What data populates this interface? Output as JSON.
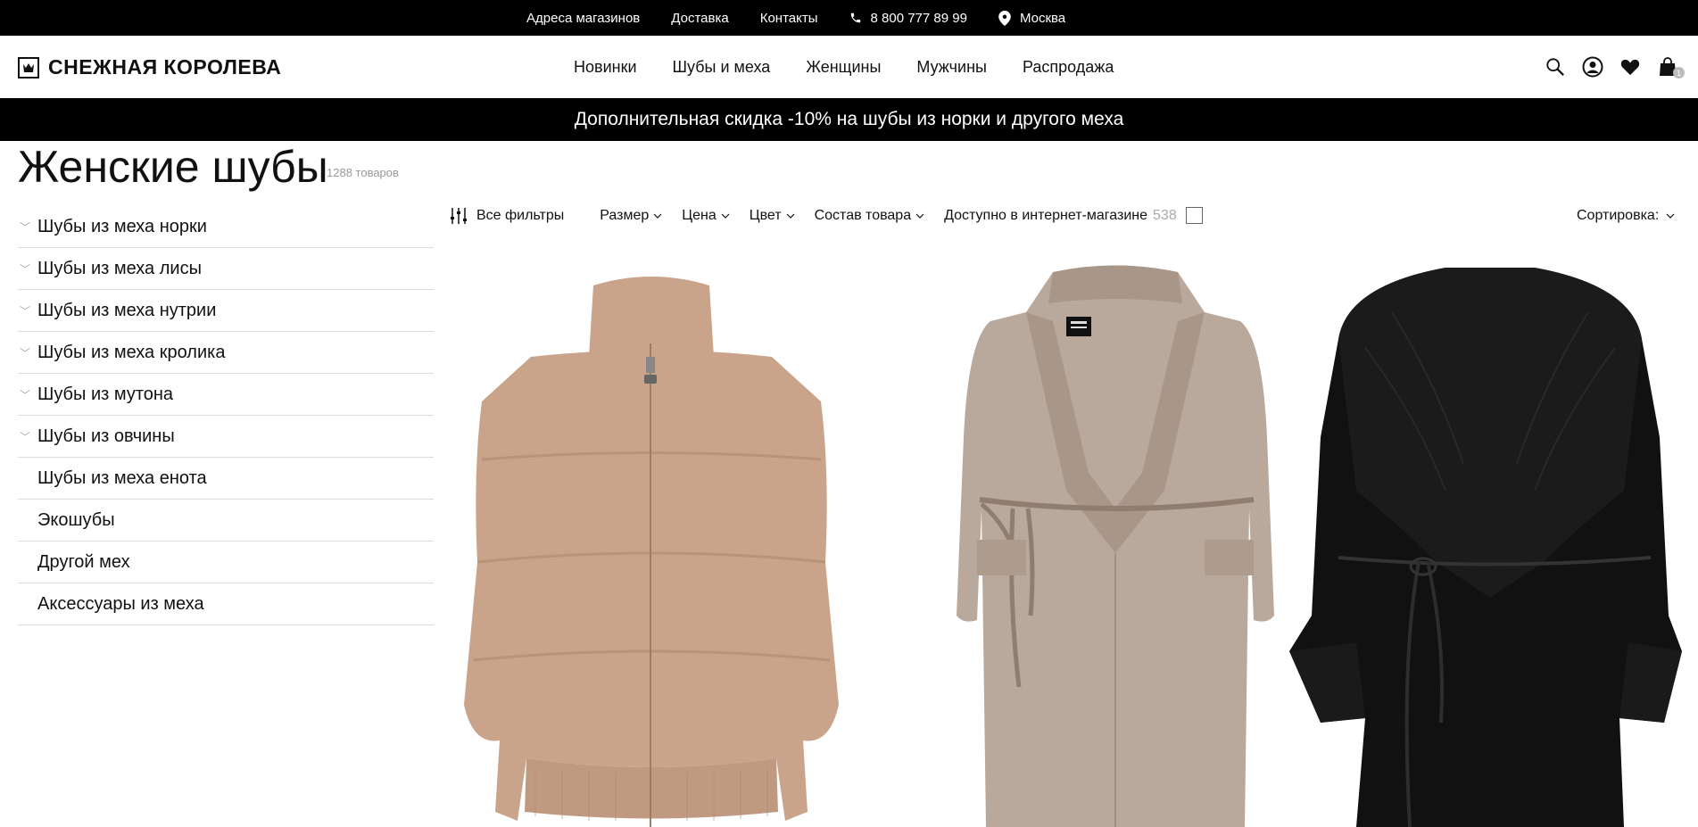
{
  "topbar": {
    "links": [
      "Адреса магазинов",
      "Доставка",
      "Контакты"
    ],
    "phone": "8 800 777 89 99",
    "city": "Москва"
  },
  "header": {
    "logo_text": "СНЕЖНАЯ КОРОЛЕВА",
    "nav": [
      "Новинки",
      "Шубы и меха",
      "Женщины",
      "Мужчины",
      "Распродажа"
    ],
    "icons": [
      "search-icon",
      "user-icon",
      "heart-icon",
      "bag-icon"
    ],
    "cart_count": "1"
  },
  "promo": {
    "text": "Дополнительная скидка -10% на шубы из норки и другого меха"
  },
  "page": {
    "title": "Женские шубы",
    "count": "1288 товаров"
  },
  "sidebar": {
    "items": [
      {
        "label": "Шубы из меха норки",
        "expandable": true
      },
      {
        "label": "Шубы из меха лисы",
        "expandable": true
      },
      {
        "label": "Шубы из меха нутрии",
        "expandable": true
      },
      {
        "label": "Шубы из меха кролика",
        "expandable": true
      },
      {
        "label": "Шубы из мутона",
        "expandable": true
      },
      {
        "label": "Шубы из овчины",
        "expandable": true
      },
      {
        "label": "Шубы из меха енота",
        "expandable": false
      },
      {
        "label": "Экошубы",
        "expandable": false
      },
      {
        "label": "Другой мех",
        "expandable": false
      },
      {
        "label": "Аксессуары из меха",
        "expandable": false
      }
    ]
  },
  "filters": {
    "all_filters": "Все фильтры",
    "size": "Размер",
    "price": "Цена",
    "color": "Цвет",
    "composition": "Состав товара",
    "available_online": "Доступно в интернет-магазине",
    "available_count": "538",
    "sort": "Сортировка:"
  },
  "products": [
    {
      "color": "#c9a48a"
    },
    {
      "color": "#b9a89c"
    },
    {
      "color": "#111111"
    }
  ],
  "colors": {
    "bar_bg": "#000000",
    "divider": "#dddddd",
    "muted": "#999999"
  }
}
